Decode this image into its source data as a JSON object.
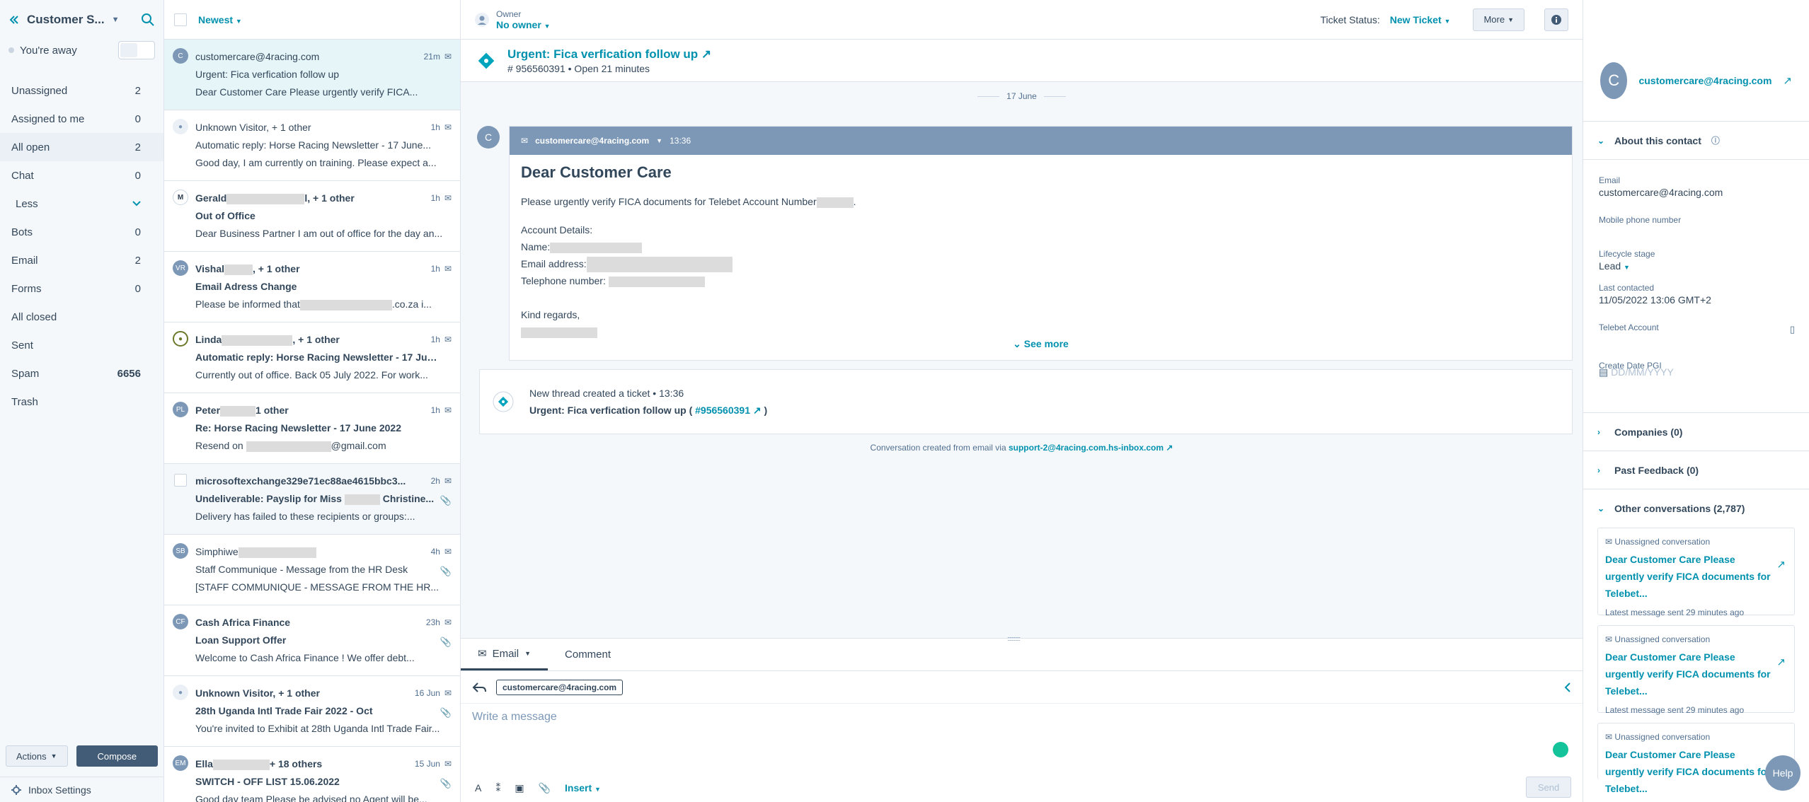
{
  "sidebar": {
    "title": "Customer S...",
    "status": "You're away",
    "items": [
      {
        "label": "Unassigned",
        "count": "2"
      },
      {
        "label": "Assigned to me",
        "count": "0"
      },
      {
        "label": "All open",
        "count": "2"
      },
      {
        "label": "Chat",
        "count": "0"
      },
      {
        "label": "Less",
        "count": ""
      },
      {
        "label": "Bots",
        "count": "0"
      },
      {
        "label": "Email",
        "count": "2"
      },
      {
        "label": "Forms",
        "count": "0"
      },
      {
        "label": "All closed",
        "count": ""
      },
      {
        "label": "Sent",
        "count": ""
      },
      {
        "label": "Spam",
        "count": "6656"
      },
      {
        "label": "Trash",
        "count": ""
      }
    ],
    "actions_label": "Actions",
    "compose_label": "Compose",
    "settings_label": "Inbox Settings"
  },
  "list": {
    "sort_label": "Newest",
    "conversations": [
      {
        "avatar": "C",
        "from": "customercare@4racing.com",
        "time": "21m",
        "subject": "Urgent: Fica verfication follow up",
        "preview": "Dear Customer Care Please urgently verify FICA..."
      },
      {
        "avatar": "",
        "from": "Unknown Visitor, + 1 other",
        "time": "1h",
        "subject": "Automatic reply: Horse Racing Newsletter - 17 June...",
        "preview": "Good day, I am currently on training. Please expect a..."
      },
      {
        "avatar": "",
        "from_a": "Gerald",
        "from_b": "l, + 1 other",
        "time": "1h",
        "subject": "Out of Office",
        "preview": "Dear Business Partner I am out of office for the day an..."
      },
      {
        "avatar": "VR",
        "from_a": "Vishal",
        "from_b": ", + 1 other",
        "time": "1h",
        "subject": "Email Adress Change",
        "preview_a": "Please be informed that",
        "preview_b": ".co.za i..."
      },
      {
        "avatar": "",
        "from_a": "Linda",
        "from_b": ", + 1 other",
        "time": "1h",
        "subject": "Automatic reply: Horse Racing Newsletter - 17 June...",
        "preview": "Currently out of office. Back 05 July 2022. For work..."
      },
      {
        "avatar": "PL",
        "from_a": "Peter",
        "from_b": "1 other",
        "time": "1h",
        "subject": "Re: Horse Racing Newsletter - 17 June 2022",
        "preview_a": "Resend on",
        "preview_b": "@gmail.com"
      },
      {
        "avatar": "",
        "from": "microsoftexchange329e71ec88ae4615bbc3...",
        "time": "2h",
        "subject_a": "Undeliverable: Payslip for Miss",
        "subject_b": "Christine...",
        "preview": "Delivery has failed to these recipients or groups:..."
      },
      {
        "avatar": "SB",
        "from_a": "Simphiwe",
        "from_b": "",
        "time": "4h",
        "subject": "Staff Communique - Message from the HR Desk",
        "preview": "[STAFF COMMUNIQUE - MESSAGE FROM THE HR..."
      },
      {
        "avatar": "CF",
        "from": "Cash Africa Finance",
        "time": "23h",
        "subject": "Loan Support Offer",
        "preview": "Welcome to Cash Africa Finance ! We offer debt..."
      },
      {
        "avatar": "",
        "from": "Unknown Visitor, + 1 other",
        "time": "16 Jun",
        "subject": "28th Uganda Intl Trade Fair 2022 - Oct",
        "preview": "You're invited to Exhibit at 28th Uganda Intl Trade Fair..."
      },
      {
        "avatar": "EM",
        "from_a": "Ella",
        "from_b": "+ 18 others",
        "time": "15 Jun",
        "subject": "SWITCH - OFF LIST 15.06.2022",
        "preview": "Good day team Please be advised no Agent will be..."
      }
    ]
  },
  "topbar": {
    "owner_label": "Owner",
    "owner_value": "No owner",
    "status_label": "Ticket Status:",
    "status_value": "New Ticket",
    "more_label": "More"
  },
  "ticket": {
    "title": "Urgent: Fica verfication follow up",
    "subtitle": "# 956560391 • Open 21 minutes"
  },
  "thread": {
    "date": "17 June",
    "avatar": "C",
    "sender": "customercare@4racing.com",
    "time": "13:36",
    "greeting": "Dear Customer Care",
    "line1": "Please urgently verify FICA documents for Telebet Account Number",
    "details_header": "Account Details:",
    "name_label": "Name:",
    "email_label": "Email address:",
    "phone_label": "Telephone number:",
    "closing": "Kind regards,",
    "see_more": "See more",
    "event_line": "New thread created a ticket • 13:36",
    "event_ticket": "Urgent: Fica verfication follow up (",
    "event_id": "#956560391",
    "event_close": ")",
    "via_text": "Conversation created from email via",
    "via_link": "support-2@4racing.com.hs-inbox.com"
  },
  "composer": {
    "tab_email": "Email",
    "tab_comment": "Comment",
    "to_chip": "customercare@4racing.com",
    "placeholder": "Write a message",
    "insert_label": "Insert",
    "send_label": "Send"
  },
  "contact": {
    "avatar": "C",
    "email": "customercare@4racing.com",
    "about_label": "About this contact",
    "props": [
      {
        "key": "Email",
        "value": "customercare@4racing.com"
      },
      {
        "key": "Mobile phone number",
        "value": ""
      },
      {
        "key": "Lifecycle stage",
        "value": "Lead"
      },
      {
        "key": "Last contacted",
        "value": "11/05/2022 13:06 GMT+2"
      },
      {
        "key": "Telebet Account",
        "value": ""
      },
      {
        "key": "Create Date PGI",
        "value": "DD/MM/YYYY"
      }
    ],
    "companies": "Companies (0)",
    "feedback": "Past Feedback (0)",
    "others": "Other conversations (2,787)",
    "other_cards": [
      {
        "kind": "Unassigned conversation",
        "title": "Dear Customer Care Please urgently verify FICA documents for Telebet...",
        "latest": "Latest message sent 29 minutes ago"
      },
      {
        "kind": "Unassigned conversation",
        "title": "Dear Customer Care Please urgently verify FICA documents for Telebet...",
        "latest": "Latest message sent 29 minutes ago"
      },
      {
        "kind": "Unassigned conversation",
        "title": "Dear Customer Care Please urgently verify FICA documents for Telebet..."
      }
    ],
    "help_label": "Help"
  }
}
